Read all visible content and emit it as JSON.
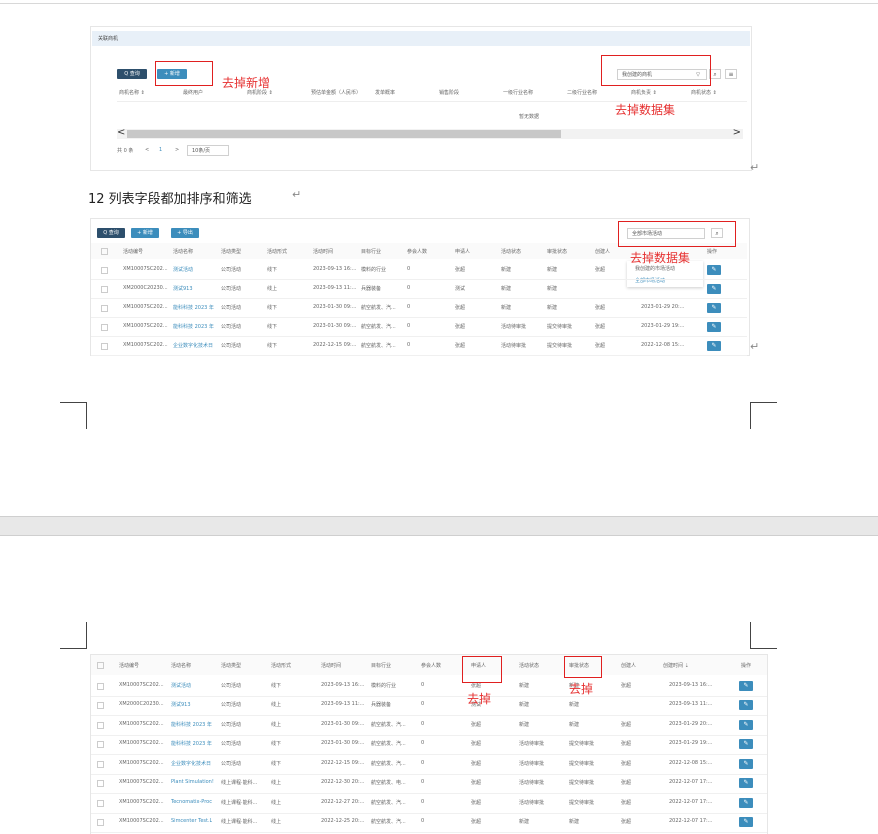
{
  "shot1": {
    "section_title": "关联商机",
    "query_btn": "Q 查询",
    "add_btn": "+ 新增",
    "select": "我创建的商机",
    "select_arrow": "▽",
    "columns": [
      "商机名称 ⇕",
      "最终用户",
      "商机阶段 ⇕",
      "预估单金额（人民币）",
      "发单概率",
      "销售阶段",
      "一级行业名称",
      "二级行业名称",
      "商机负责 ⇕",
      "商机状态 ⇕"
    ],
    "empty": "暂无数据",
    "scroll_left": "<",
    "scroll_right": ">",
    "total": "共 0 条",
    "prev": "<",
    "page": "1",
    "next": ">",
    "pagesize": "10条/页",
    "ann_add": "去掉新增",
    "ann_dataset": "去掉数据集"
  },
  "para12": "12 列表字段都加排序和筛选",
  "return_mark": "↵",
  "shot2": {
    "query_btn": "Q 查询",
    "add_btn": "+ 新增",
    "export_btn": "+ 导出",
    "select": "全部市场活动",
    "dropdown": [
      "我创建的市场活动",
      "全部市场活动"
    ],
    "ann": "去掉数据集",
    "columns": [
      "活动编号",
      "活动名称",
      "活动类型",
      "活动形式",
      "活动时间",
      "目标行业",
      "参会人数",
      "申请人",
      "活动状态",
      "审批状态",
      "创建人",
      "",
      "操作"
    ],
    "rows": [
      [
        "XM10007SC202...",
        "测试活动",
        "公司活动",
        "线下",
        "2023-09-13 16:...",
        "模料的行业",
        "0",
        "张超",
        "新建",
        "新建",
        "张超",
        ""
      ],
      [
        "XM2000C20230...",
        "测试913",
        "公司活动",
        "线上",
        "2023-09-13 11:...",
        "兵器装备",
        "0",
        "测试",
        "新建",
        "新建",
        "",
        ""
      ],
      [
        "XM10007SC202...",
        "能科科技 2023 年",
        "公司活动",
        "线下",
        "2023-01-30 09:...",
        "航空航发、汽...",
        "0",
        "张超",
        "新建",
        "新建",
        "张超",
        "2023-01-29 20:..."
      ],
      [
        "XM10007SC202...",
        "能科科技 2023 年",
        "公司活动",
        "线下",
        "2023-01-30 09:...",
        "航空航发、汽...",
        "0",
        "张超",
        "活动待审批",
        "提交待审批",
        "张超",
        "2023-01-29 19:..."
      ],
      [
        "XM10007SC202...",
        "企业数字化技术日",
        "公司活动",
        "线下",
        "2022-12-15 09:...",
        "航空航发、汽...",
        "0",
        "张超",
        "活动待审批",
        "提交待审批",
        "张超",
        "2022-12-08 15:..."
      ]
    ]
  },
  "shot3": {
    "columns": [
      "活动编号",
      "活动名称",
      "活动类型",
      "活动形式",
      "活动时间",
      "目标行业",
      "参会人数",
      "申请人",
      "活动状态",
      "审批状态",
      "创建人",
      "创建时间 ⇣",
      "操作"
    ],
    "ann_applicant": "去掉",
    "ann_status": "去掉",
    "rows": [
      [
        "XM10007SC202...",
        "测试活动",
        "公司活动",
        "线下",
        "2023-09-13 16:...",
        "模料的行业",
        "0",
        "张超",
        "新建",
        "新建",
        "张超",
        "2023-09-13 16:..."
      ],
      [
        "XM2000C20230...",
        "测试913",
        "公司活动",
        "线上",
        "2023-09-13 11:...",
        "兵器装备",
        "0",
        "测试",
        "新建",
        "新建",
        "",
        "2023-09-13 11:..."
      ],
      [
        "XM10007SC202...",
        "能科科技 2023 年",
        "公司活动",
        "线上",
        "2023-01-30 09:...",
        "航空航发、汽...",
        "0",
        "张超",
        "新建",
        "新建",
        "张超",
        "2023-01-29 20:..."
      ],
      [
        "XM10007SC202...",
        "能科科技 2023 年",
        "公司活动",
        "线下",
        "2023-01-30 09:...",
        "航空航发、汽...",
        "0",
        "张超",
        "活动待审批",
        "提交待审批",
        "张超",
        "2023-01-29 19:..."
      ],
      [
        "XM10007SC202...",
        "企业数字化技术日",
        "公司活动",
        "线下",
        "2022-12-15 09:...",
        "航空航发、汽...",
        "0",
        "张超",
        "活动待审批",
        "提交待审批",
        "张超",
        "2022-12-08 15:..."
      ],
      [
        "XM10007SC202...",
        "Plant Simulation!",
        "线上课程·能科...",
        "线上",
        "2022-12-30 20:...",
        "航空航发、电...",
        "0",
        "张超",
        "活动待审批",
        "提交待审批",
        "张超",
        "2022-12-07 17:..."
      ],
      [
        "XM10007SC202...",
        "Tecnomatix-Proc",
        "线上课程·能科...",
        "线上",
        "2022-12-27 20:...",
        "航空航发、汽...",
        "0",
        "张超",
        "活动待审批",
        "提交待审批",
        "张超",
        "2022-12-07 17:..."
      ],
      [
        "XM10007SC202...",
        "Simcenter Test.L",
        "线上课程·能科...",
        "线上",
        "2022-12-25 20:...",
        "航空航发、汽...",
        "0",
        "张超",
        "新建",
        "新建",
        "张超",
        "2022-12-07 17:..."
      ]
    ]
  }
}
